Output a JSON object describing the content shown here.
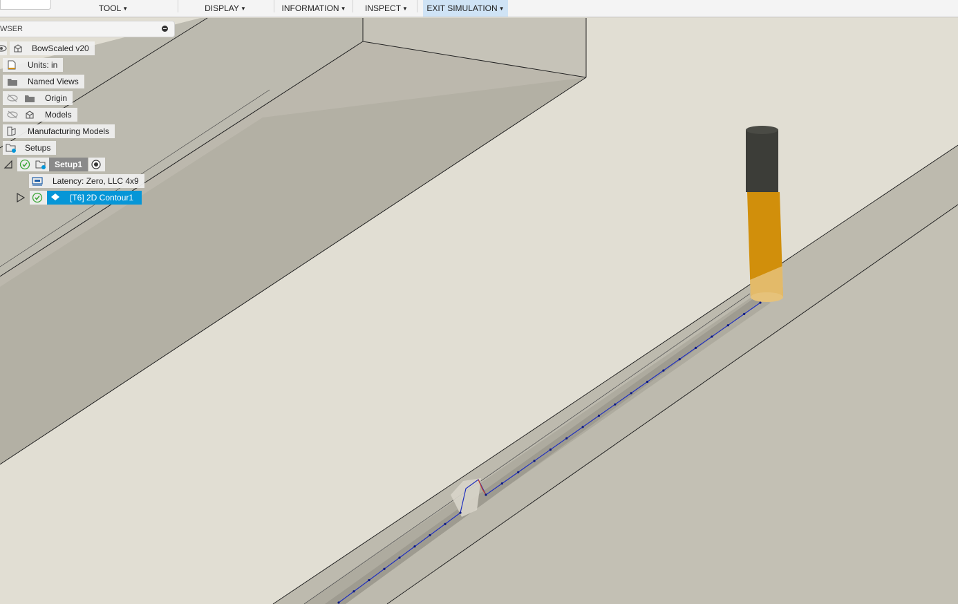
{
  "toolbar": {
    "menus": [
      {
        "label": "TOOL"
      },
      {
        "label": "DISPLAY"
      },
      {
        "label": "INFORMATION"
      },
      {
        "label": "INSPECT"
      },
      {
        "label": "EXIT SIMULATION"
      }
    ]
  },
  "browser": {
    "title": "WSER",
    "root": {
      "label": "BowScaled v20"
    },
    "units": {
      "label": "Units: in"
    },
    "named_views": {
      "label": "Named Views"
    },
    "origin": {
      "label": "Origin"
    },
    "models": {
      "label": "Models"
    },
    "manufacturing_models": {
      "label": "Manufacturing Models"
    },
    "setups": {
      "label": "Setups"
    },
    "setup1": {
      "label": "Setup1"
    },
    "machine": {
      "label": "Latency: Zero, LLC 4x9"
    },
    "operation": {
      "label": "[T6] 2D Contour1"
    }
  },
  "colors": {
    "accent": "#0696d7",
    "toolpath": "#1f2fbf",
    "tool_holder": "#3c3d38",
    "tool_flute": "#d18f0b",
    "check_green": "#3aa634"
  }
}
